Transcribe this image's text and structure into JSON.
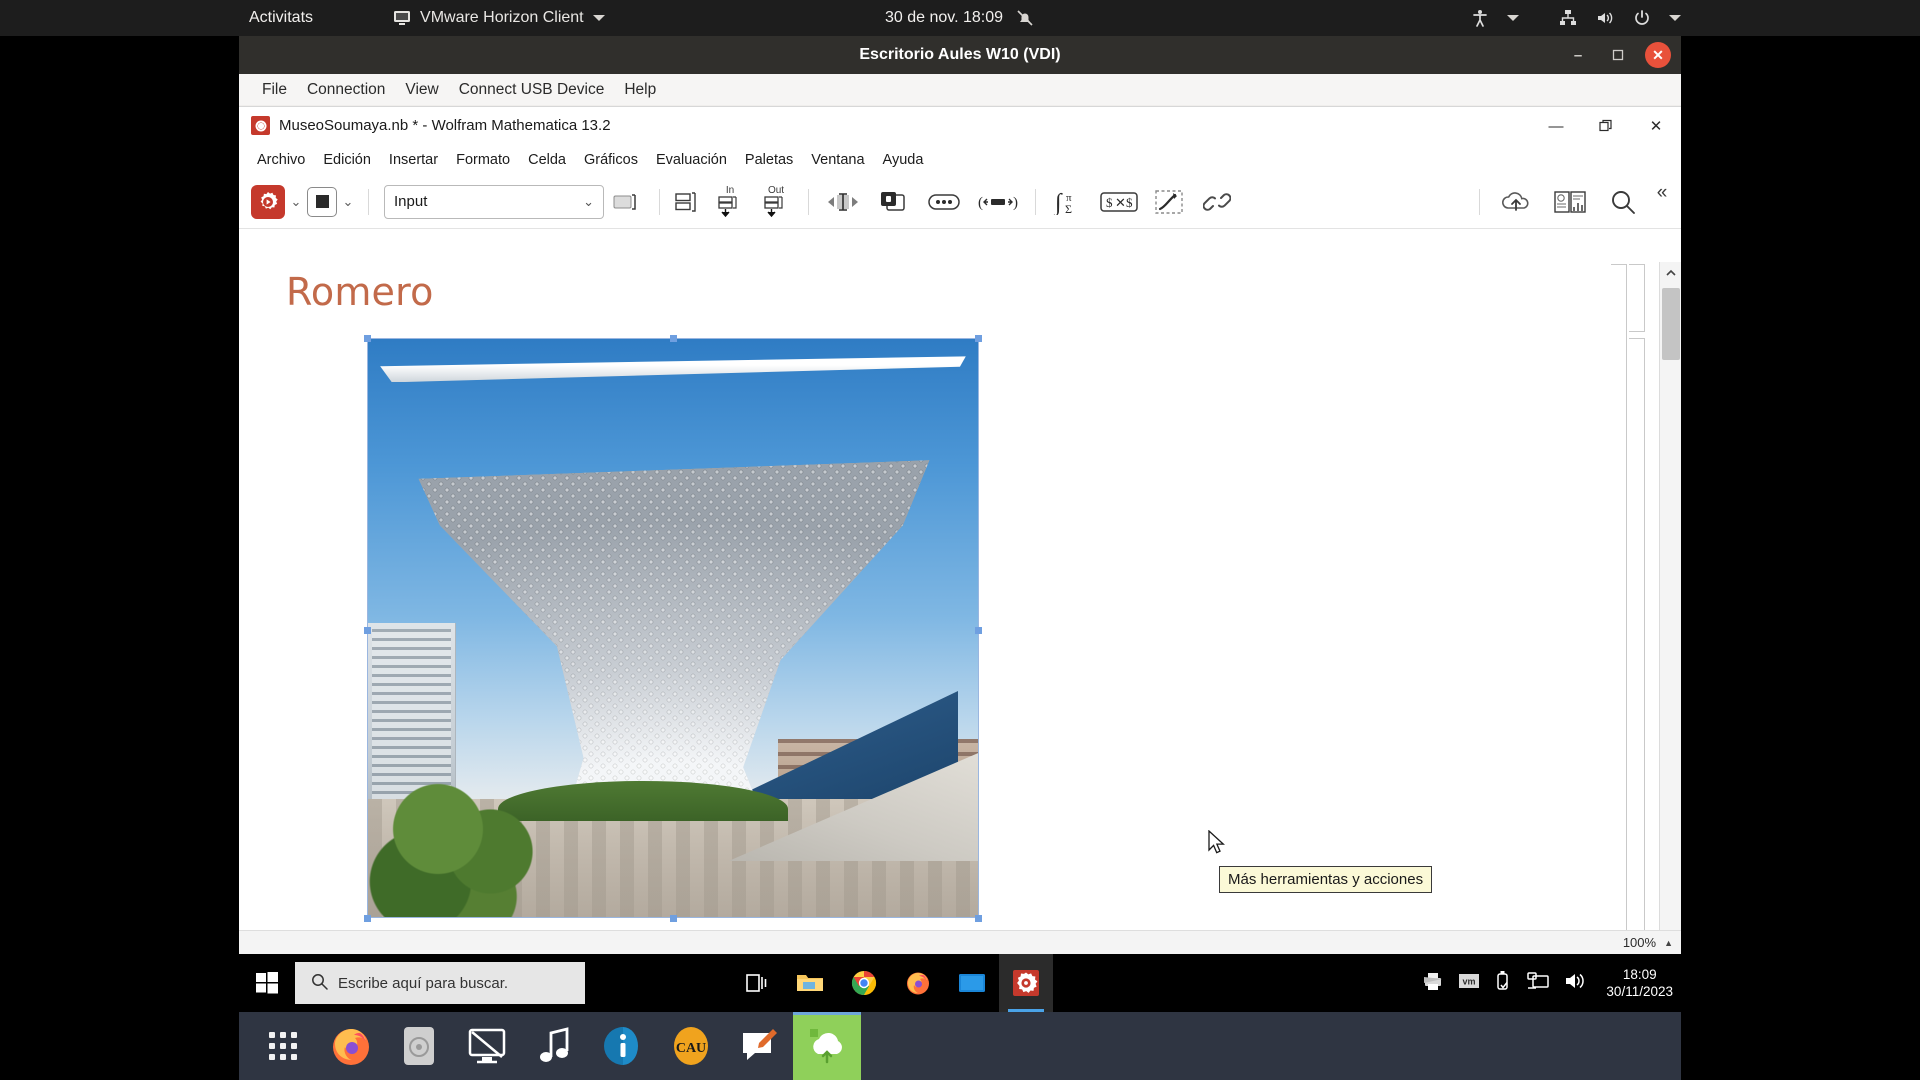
{
  "gnome_topbar": {
    "activities": "Activitats",
    "app_menu": "VMware Horizon Client",
    "clock": "30 de nov.  18:09",
    "icons": {
      "app": "monitor-icon",
      "notification_off": "bell-slash-icon",
      "accessibility": "accessibility-icon",
      "network": "network-wired-icon",
      "volume": "volume-icon",
      "power": "power-icon",
      "caret": "chevron-down-icon"
    }
  },
  "vdi_window": {
    "title": "Escritorio Aules W10 (VDI)",
    "buttons": {
      "minimize": "–",
      "maximize": "❐",
      "close": "✕"
    },
    "menu": [
      "File",
      "Connection",
      "View",
      "Connect USB Device",
      "Help"
    ]
  },
  "mathematica": {
    "title": "MuseoSoumaya.nb * - Wolfram Mathematica 13.2",
    "window_buttons": {
      "minimize": "—",
      "restore": "❐",
      "close": "✕"
    },
    "menu": [
      "Archivo",
      "Edición",
      "Insertar",
      "Formato",
      "Celda",
      "Gráficos",
      "Evaluación",
      "Paletas",
      "Ventana",
      "Ayuda"
    ],
    "toolbar": {
      "run_button": "evaluate-run-icon",
      "run_dropdown": "chevron-down-icon",
      "abort_button": "abort-stop-icon",
      "abort_dropdown": "chevron-down-icon",
      "style_select_value": "Input",
      "style_select_caret": "chevron-down-icon",
      "cell_insert": "cell-bracket-icon",
      "group_cells": "group-cells-icon",
      "in_label": "In",
      "out_label": "Out",
      "more_tools": "more-tools-icon",
      "duplicate": "duplicate-icon",
      "ellipsis": "ellipsis-icon",
      "slider_tool": "slider-icon",
      "math_input": "integral-sigma-icon",
      "wolfram_alpha": "dollar-x-dollar-icon",
      "freehand": "freehand-draw-icon",
      "hyperlink": "link-icon",
      "cloud_upload": "cloud-upload-icon",
      "documentation": "documentation-book-icon",
      "search": "search-icon",
      "collapse": "chevrons-left-icon"
    },
    "notebook": {
      "heading": "Romero",
      "image_alt": "Museo Soumaya"
    },
    "status": {
      "zoom": "100%",
      "zoom_caret": "▲"
    },
    "scrollbar": {
      "up": "▲",
      "down": "▼"
    }
  },
  "tooltip": {
    "text": "Más herramientas y acciones"
  },
  "windows_taskbar": {
    "start": "windows-logo-icon",
    "search_placeholder": "Escribe aquí para buscar.",
    "search_icon": "search-icon",
    "apps": [
      {
        "name": "task-view-icon"
      },
      {
        "name": "file-explorer-icon"
      },
      {
        "name": "google-chrome-icon"
      },
      {
        "name": "firefox-icon"
      },
      {
        "name": "remote-window-icon"
      },
      {
        "name": "mathematica-icon",
        "active": true
      }
    ],
    "tray": [
      "printer-icon",
      "vmware-icon",
      "usb-icon",
      "network-icon",
      "volume-icon"
    ],
    "clock_time": "18:09",
    "clock_date": "30/11/2023"
  },
  "ubuntu_dock": {
    "items": [
      {
        "name": "show-applications-icon"
      },
      {
        "name": "firefox-icon"
      },
      {
        "name": "disk-image-icon"
      },
      {
        "name": "display-settings-icon"
      },
      {
        "name": "music-icon"
      },
      {
        "name": "info-icon"
      },
      {
        "name": "cau-icon",
        "label": "CAU"
      },
      {
        "name": "feedback-icon"
      },
      {
        "name": "vmware-horizon-icon",
        "active": true
      }
    ]
  }
}
